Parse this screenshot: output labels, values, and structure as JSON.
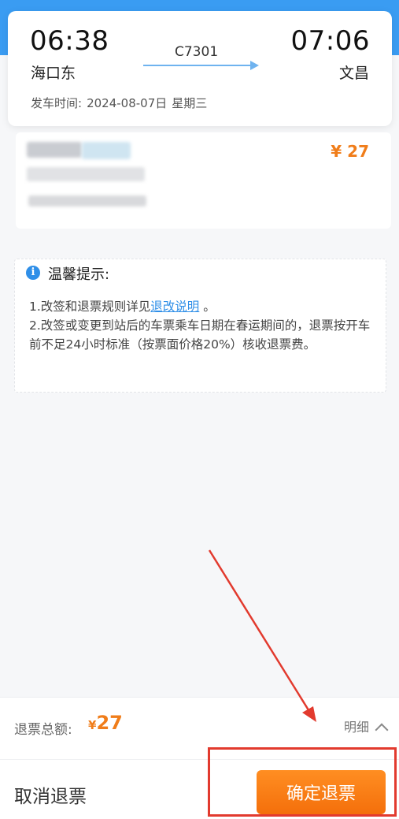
{
  "trip": {
    "departure_time": "06:38",
    "arrival_time": "07:06",
    "departure_station": "海口东",
    "arrival_station": "文昌",
    "train_number": "C7301",
    "depart_label": "发车时间:",
    "depart_date": "2024-08-07日",
    "depart_weekday": "星期三"
  },
  "passenger": {
    "price": "¥ 27"
  },
  "tips": {
    "title": "温馨提示:",
    "line1_prefix": "1.改签和退票规则详见",
    "line1_link": "退改说明",
    "line1_suffix": " 。",
    "line2": "2.改签或变更到站后的车票乘车日期在春运期间的，退票按开车前不足24小时标准（按票面价格20%）核收退票费。"
  },
  "footer": {
    "total_label": "退票总额:",
    "total_currency": "¥",
    "total_value": "27",
    "detail_label": "明细",
    "cancel_label": "取消退票",
    "confirm_label": "确定退票"
  },
  "colors": {
    "accent_orange": "#f07d1a",
    "link_blue": "#2f8fe8",
    "annotation_red": "#e23a2e",
    "header_blue": "#3a9cf2"
  },
  "icons": [
    "info-icon",
    "chevron-up-icon"
  ]
}
